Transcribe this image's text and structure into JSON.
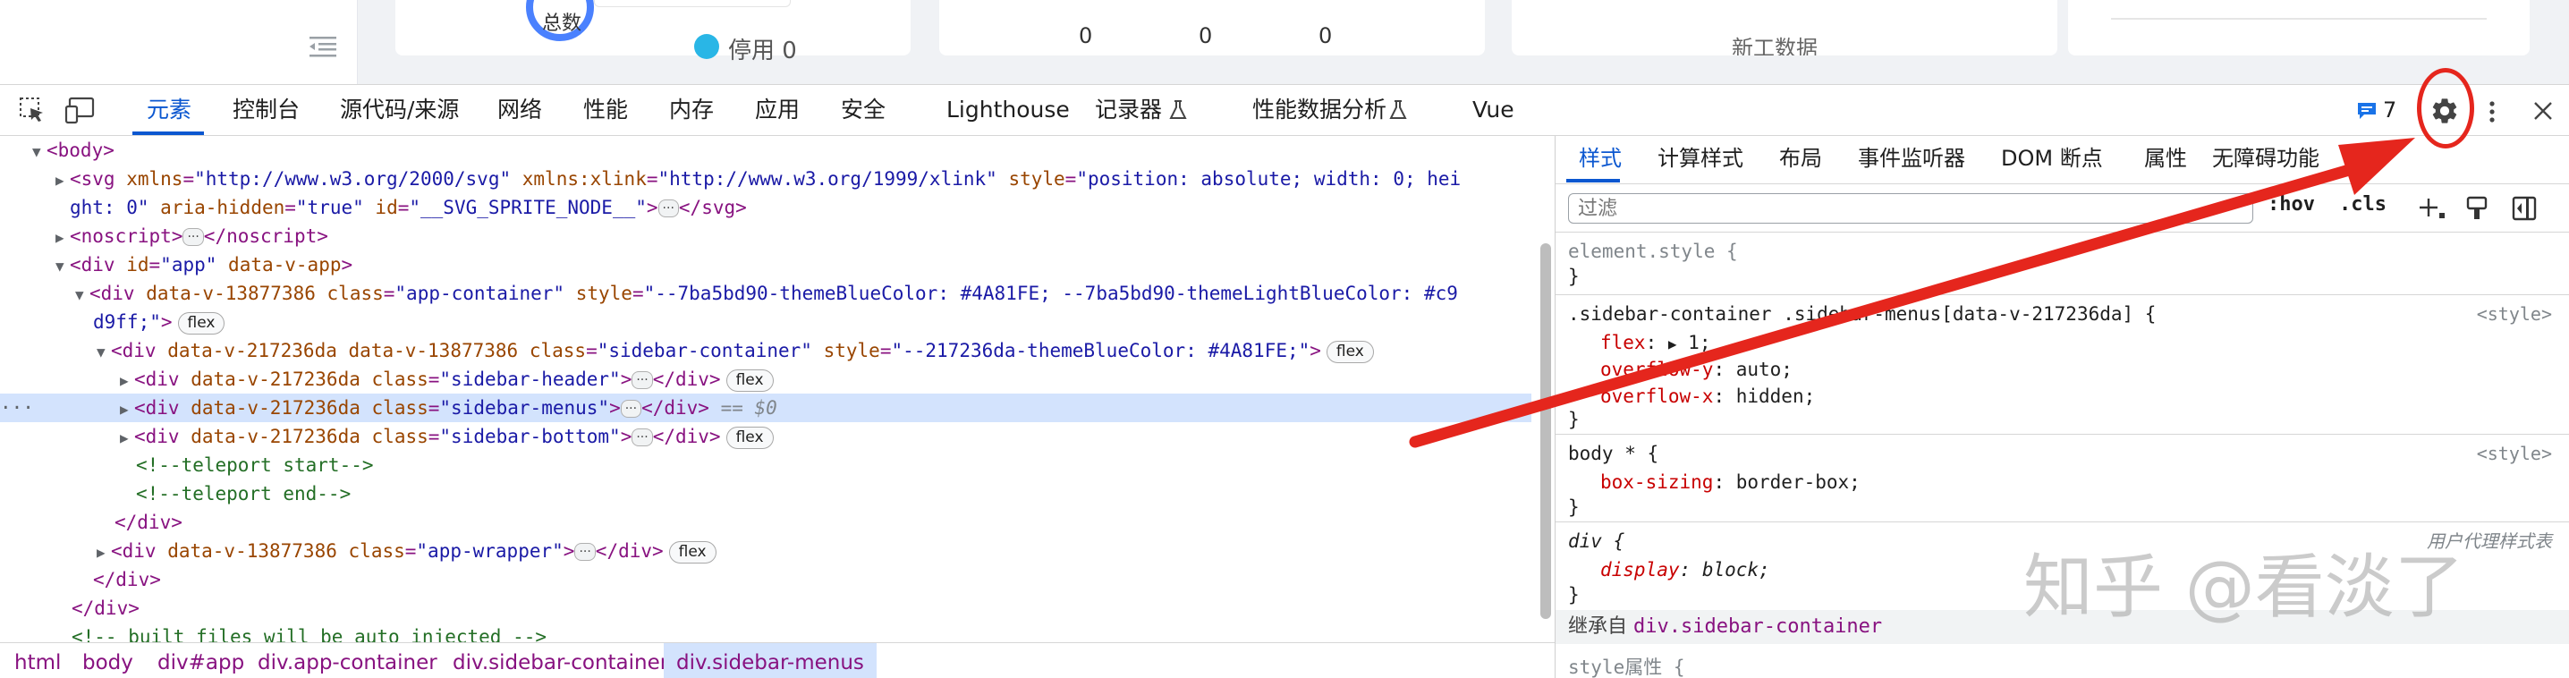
{
  "app": {
    "ring_label": "总数",
    "disabled_label": "停用 0",
    "zeros": [
      "0",
      "0",
      "0"
    ],
    "new_data_label": "新工数据"
  },
  "devtools": {
    "tabs": [
      {
        "label": "元素",
        "active": true
      },
      {
        "label": "控制台"
      },
      {
        "label": "源代码/来源"
      },
      {
        "label": "网络"
      },
      {
        "label": "性能"
      },
      {
        "label": "内存"
      },
      {
        "label": "应用"
      },
      {
        "label": "安全"
      },
      {
        "label": "Lighthouse"
      },
      {
        "label": "记录器"
      },
      {
        "label": "性能数据分析"
      },
      {
        "label": "Vue"
      }
    ],
    "issues_count": "7",
    "icons": [
      "inspect-element-icon",
      "device-toolbar-icon",
      "flask-icon",
      "issues-icon",
      "gear-icon",
      "more-vertical-icon",
      "close-icon"
    ]
  },
  "dom": {
    "body_tag": "<body>",
    "svg_line1_a": "<svg ",
    "svg_attr_xmlns": "xmlns",
    "svg_val_xmlns": "\"http://www.w3.org/2000/svg\"",
    "svg_attr_xlink": "xmlns:xlink",
    "svg_val_xlink": "\"http://www.w3.org/1999/xlink\"",
    "svg_attr_style": "style",
    "svg_val_style_a": "\"position: absolute; width: 0; hei",
    "svg_val_style_b": "ght: 0\"",
    "svg_attr_aria": "aria-hidden",
    "svg_val_aria": "\"true\"",
    "svg_attr_id": "id",
    "svg_val_id": "\"__SVG_SPRITE_NODE__\"",
    "svg_close": "</svg>",
    "noscript_open": "<noscript>",
    "noscript_close": "</noscript>",
    "div_app_open": "<div ",
    "div_app_id_attr": "id",
    "div_app_id_val": "\"app\"",
    "div_app_attr2": "data-v-app",
    "container_attr1": "data-v-13877386",
    "container_class_val": "\"app-container\"",
    "container_style_a": "\"--7ba5bd90-themeBlueColor: #4A81FE; --7ba5bd90-themeLightBlueColor: #c9",
    "container_style_b": "d9ff;\"",
    "sidebar_attr1": "data-v-217236da",
    "sidebar_class_val": "\"sidebar-container\"",
    "sidebar_style_val": "\"--217236da-themeBlueColor: #4A81FE;\"",
    "header_class_val": "\"sidebar-header\"",
    "menus_class_val": "\"sidebar-menus\"",
    "bottom_class_val": "\"sidebar-bottom\"",
    "teleport_start": "<!--teleport start-->",
    "teleport_end": "<!--teleport end-->",
    "div_close": "</div>",
    "wrapper_class_val": "\"app-wrapper\"",
    "built_comment": "<!-- built files will be auto injected -->",
    "flex_badge": "flex",
    "class_attr": "class",
    "style_attr": "style",
    "eq_dollar": "== $0",
    "row_marker": "···"
  },
  "breadcrumbs": [
    "html",
    "body",
    "div#app",
    "div.app-container",
    "div.sidebar-container",
    "div.sidebar-menus"
  ],
  "styles_pane": {
    "tabs": [
      "样式",
      "计算样式",
      "布局",
      "事件监听器",
      "DOM 断点",
      "属性",
      "无障碍功能"
    ],
    "filter_placeholder": "过滤",
    "hov": ":hov",
    "cls": ".cls",
    "element_style_selector": "element.style {",
    "close_brace": "}",
    "rule1_selector": ".sidebar-container .sidebar-menus[data-v-217236da] {",
    "rule1_source": "<style>",
    "rule1_props": [
      {
        "name": "flex",
        "value": "1;"
      },
      {
        "name": "overflow-y",
        "value": "auto;"
      },
      {
        "name": "overflow-x",
        "value": "hidden;"
      }
    ],
    "rule2_selector": "body * {",
    "rule2_source": "<style>",
    "rule2_props": [
      {
        "name": "box-sizing",
        "value": "border-box;"
      }
    ],
    "rule3_selector": "div {",
    "rule3_source": "用户代理样式表",
    "rule3_props": [
      {
        "name": "display",
        "value": "block;"
      }
    ],
    "inherited_label": "继承自",
    "inherited_target": "div.sidebar-container",
    "style_attr_label": "style属性 {"
  },
  "watermark": "知乎 @看淡了",
  "colors": {
    "accent": "#0b57d0",
    "annotation_red": "#e5261d",
    "theme_blue": "#4A81FE"
  }
}
